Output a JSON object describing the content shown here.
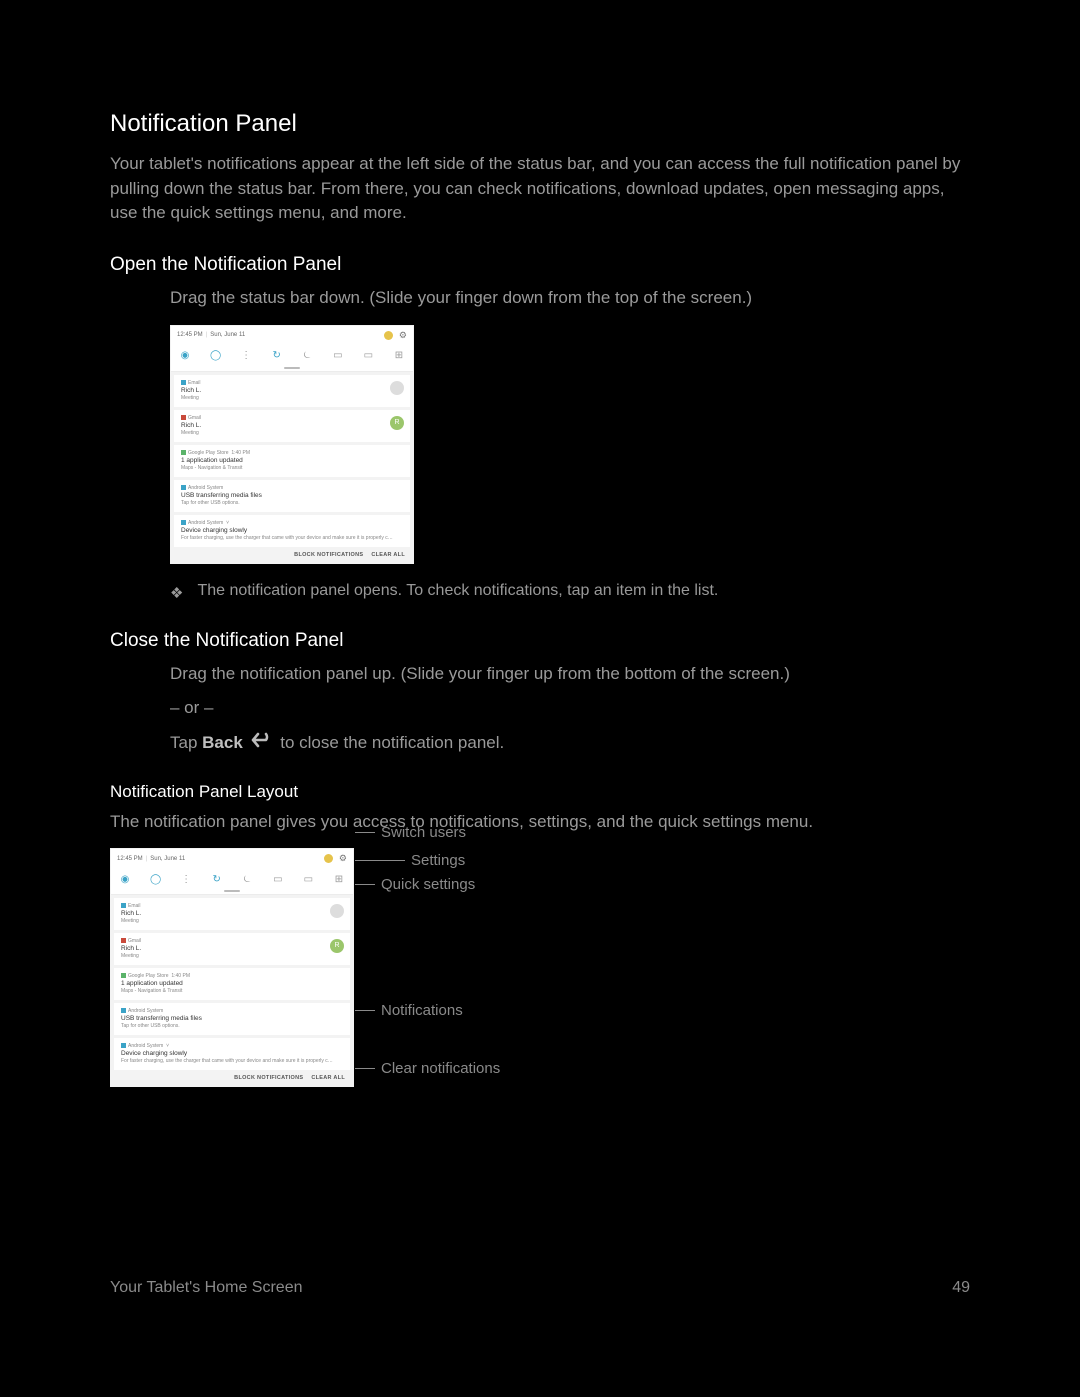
{
  "headings": {
    "main": "Notification Panel",
    "open": "Open the Notification Panel",
    "close": "Close the Notification Panel",
    "layout": "Notification Panel Layout"
  },
  "para": {
    "intro": "Your tablet's notifications appear at the left side of the status bar, and you can access the full notification panel by pulling down the status bar. From there, you can check notifications, download updates, open messaging apps, use the quick settings menu, and more.",
    "drag_down": "Drag the status bar down. (Slide your finger down from the top of the screen.)",
    "opens": "The notification panel opens. To check notifications, tap an item in the list.",
    "drag_up": "Drag the notification panel up. (Slide your finger up from the bottom of the screen.)",
    "or": "– or –",
    "tap": "Tap ",
    "back_word": "Back",
    "to_close": " to close the notification panel.",
    "layout": "The notification panel gives you access to notifications, settings, and the quick settings menu."
  },
  "footer": {
    "left": "Your Tablet's Home Screen",
    "right": "49"
  },
  "panel": {
    "time": "12:45 PM",
    "date": "Sun, June 11",
    "notifs": [
      {
        "app": "Email",
        "title": "Rich L.",
        "body": "Meeting",
        "avatar": "grey",
        "icon": "#3ba3c7"
      },
      {
        "app": "Gmail",
        "title": "Rich L.",
        "body": "Meeting",
        "avatar": "green",
        "avatar_letter": "R",
        "icon": "#c94a3b"
      },
      {
        "app": "Google Play Store",
        "time": "1:40 PM",
        "title": "1 application updated",
        "body": "Maps - Navigation & Transit",
        "icon": "#5bb36a"
      },
      {
        "app": "Android System",
        "title": "USB transferring media files",
        "body": "Tap for other USB options.",
        "icon": "#3ba3c7"
      },
      {
        "app": "Android System",
        "chevron": true,
        "title": "Device charging slowly",
        "body": "For faster charging, use the charger that came with your device and make sure it is properly c…",
        "icon": "#3ba3c7"
      }
    ],
    "actions": {
      "block": "BLOCK NOTIFICATIONS",
      "clear": "CLEAR ALL"
    }
  },
  "callouts": {
    "switch": "Switch users",
    "settings": "Settings",
    "quick": "Quick settings",
    "notifs": "Notifications",
    "clear": "Clear notifications"
  }
}
